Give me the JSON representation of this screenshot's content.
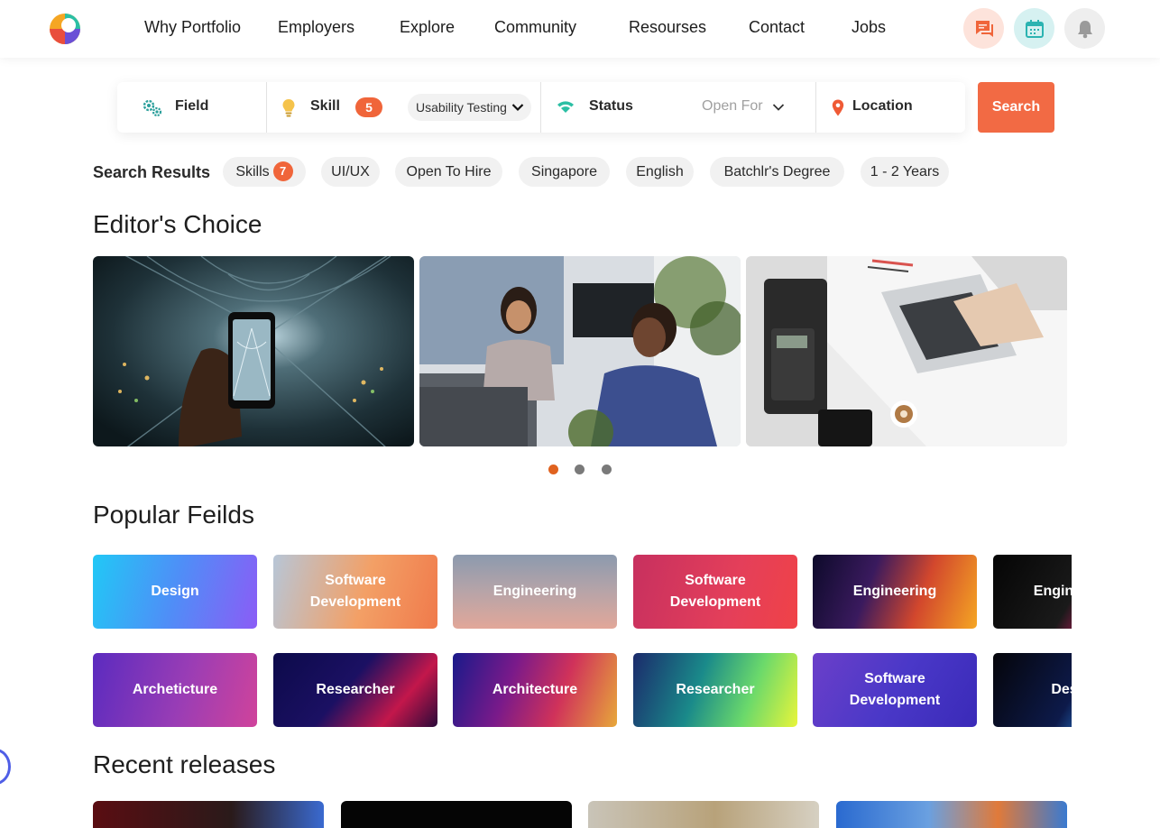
{
  "nav": {
    "logo": "portfolio-logo",
    "items": [
      "Why Portfolio",
      "Employers",
      "Explore",
      "Community",
      "Resourses",
      "Contact",
      "Jobs"
    ],
    "icons": [
      "chat-icon",
      "calendar-icon",
      "bell-icon"
    ]
  },
  "search": {
    "field_label": "Field",
    "skill_label": "Skill",
    "skill_count": "5",
    "skill_value": "Usability Testing",
    "status_label": "Status",
    "status_value": "Open For Hire",
    "location_label": "Location",
    "button_label": "Search"
  },
  "results": {
    "label": "Search Results",
    "chips": [
      {
        "label": "Skills",
        "count": "7"
      },
      {
        "label": "UI/UX"
      },
      {
        "label": "Open To Hire"
      },
      {
        "label": "Singapore"
      },
      {
        "label": "English"
      },
      {
        "label": "Batchlr's Degree"
      },
      {
        "label": "1 - 2 Years"
      }
    ]
  },
  "editors_choice": {
    "title": "Editor's Choice",
    "images": [
      "phone-in-tunnel-photo",
      "office-coworkers-photo",
      "laptop-desk-photo"
    ],
    "active_slide": 1,
    "slide_count": 3
  },
  "popular_fields": {
    "title": "Popular Feilds",
    "row1": [
      "Design",
      "Software Development",
      "Engineering",
      "Software Development",
      "Engineering",
      "Engineering"
    ],
    "row2": [
      "Archeticture",
      "Researcher",
      "Architecture",
      "Researcher",
      "Software Development",
      "Design"
    ]
  },
  "recent_releases": {
    "title": "Recent releases"
  },
  "colors": {
    "accent": "#f26a44",
    "dot_active": "#e0621f",
    "dot_inactive": "#7a7a7a"
  }
}
